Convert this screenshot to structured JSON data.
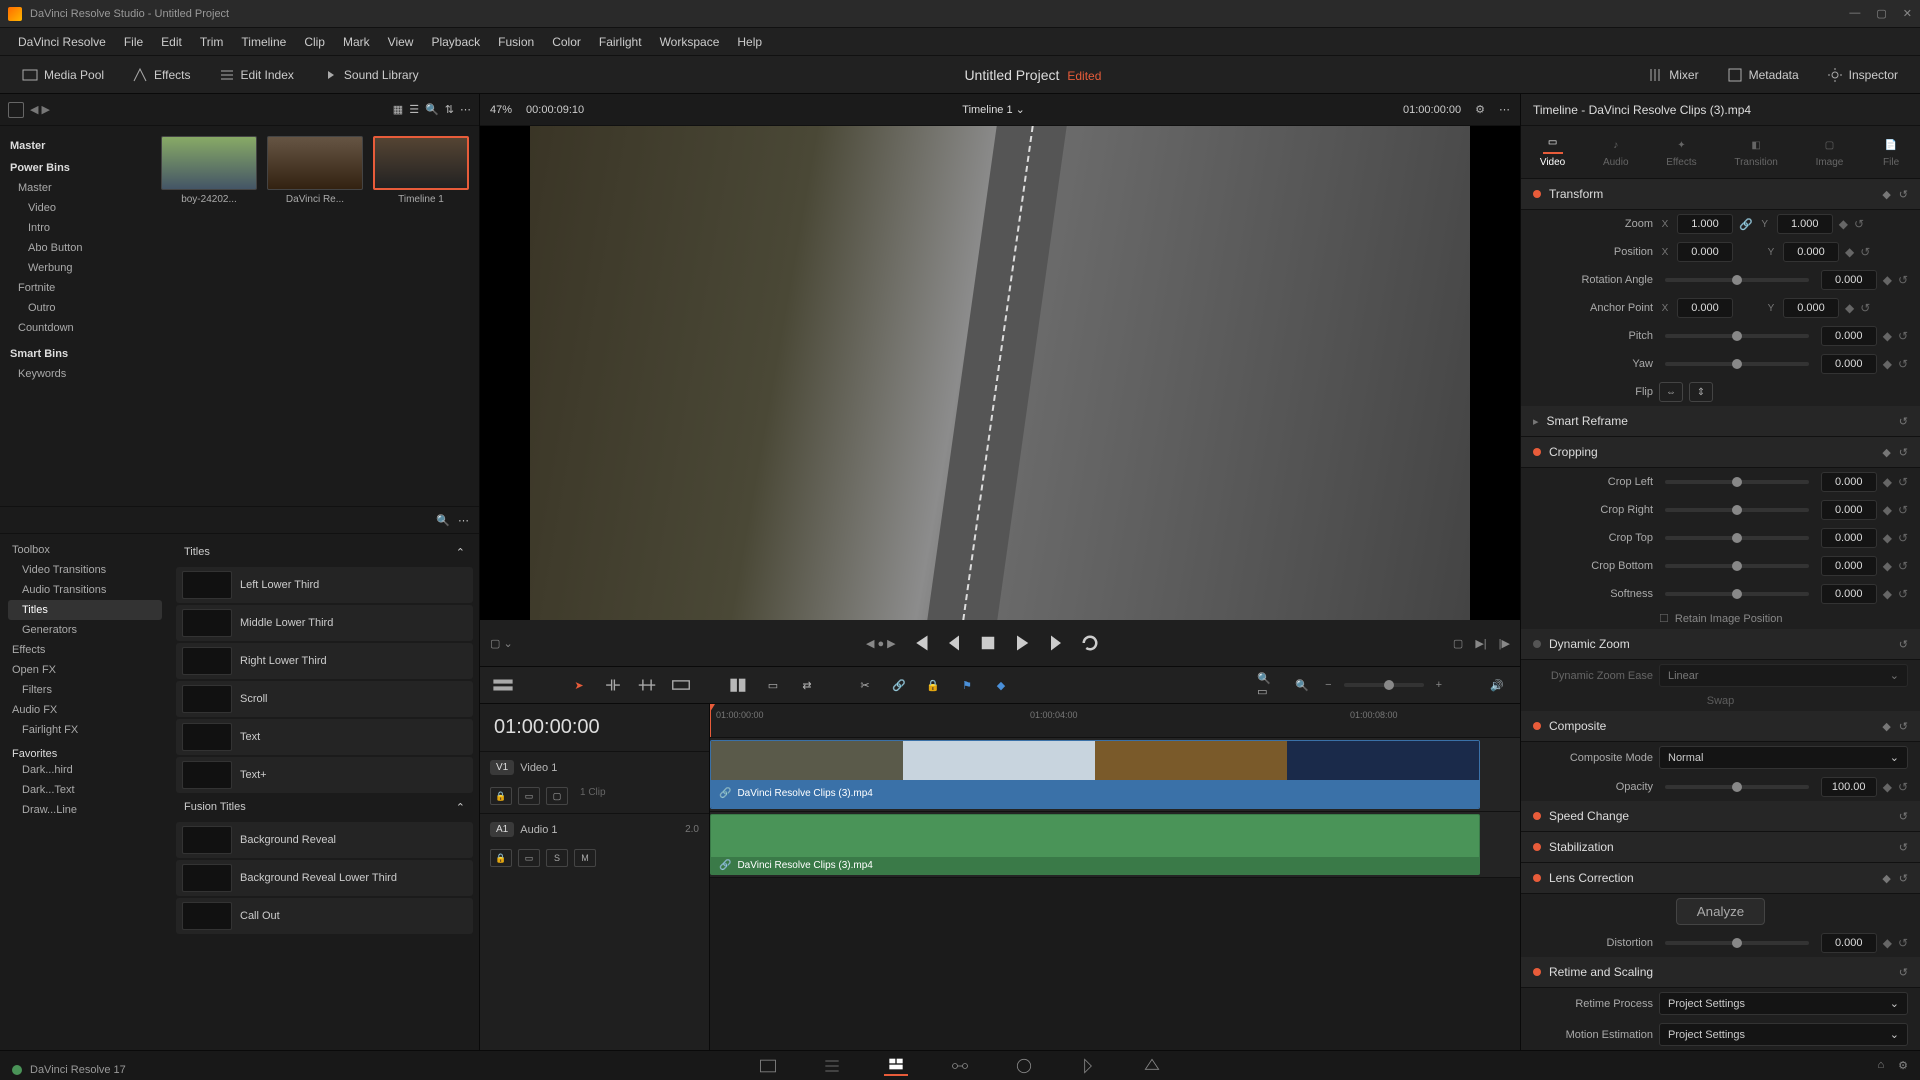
{
  "titlebar": {
    "text": "DaVinci Resolve Studio - Untitled Project"
  },
  "menu": [
    "DaVinci Resolve",
    "File",
    "Edit",
    "Trim",
    "Timeline",
    "Clip",
    "Mark",
    "View",
    "Playback",
    "Fusion",
    "Color",
    "Fairlight",
    "Workspace",
    "Help"
  ],
  "topbar": {
    "mediapool": "Media Pool",
    "effects": "Effects",
    "editindex": "Edit Index",
    "soundlib": "Sound Library",
    "project": "Untitled Project",
    "edited": "Edited",
    "mixer": "Mixer",
    "metadata": "Metadata",
    "inspector": "Inspector"
  },
  "viewer": {
    "zoom": "47%",
    "src_tc": "00:00:09:10",
    "name": "Timeline 1",
    "rec_tc": "01:00:00:00"
  },
  "bins": {
    "master": "Master",
    "power": "Power Bins",
    "items": [
      "Master",
      "Video",
      "Intro",
      "Abo Button",
      "Werbung",
      "Fortnite",
      "Outro",
      "Countdown"
    ],
    "smart": "Smart Bins",
    "keywords": "Keywords"
  },
  "thumbs": [
    {
      "label": "boy-24202..."
    },
    {
      "label": "DaVinci Re..."
    },
    {
      "label": "Timeline 1"
    }
  ],
  "fx": {
    "toolbox": "Toolbox",
    "tree": [
      "Video Transitions",
      "Audio Transitions",
      "Titles",
      "Generators"
    ],
    "effects": "Effects",
    "openfx": "Open FX",
    "filters": "Filters",
    "audiofx": "Audio FX",
    "fairlightfx": "Fairlight FX",
    "favorites": "Favorites",
    "favs": [
      "Dark...hird",
      "Dark...Text",
      "Draw...Line"
    ],
    "group1": "Titles",
    "titles": [
      "Left Lower Third",
      "Middle Lower Third",
      "Right Lower Third",
      "Scroll",
      "Text",
      "Text+"
    ],
    "group2": "Fusion Titles",
    "fusion": [
      "Background Reveal",
      "Background Reveal Lower Third",
      "Call Out"
    ]
  },
  "timeline": {
    "tc": "01:00:00:00",
    "v_label": "Video 1",
    "v_badge": "V1",
    "v_sub": "1 Clip",
    "a_label": "Audio 1",
    "a_badge": "A1",
    "a_ch": "2.0",
    "clip": "DaVinci Resolve Clips (3).mp4",
    "ticks": [
      "01:00:00:00",
      "01:00:04:00",
      "01:00:08:00"
    ]
  },
  "inspector": {
    "title": "Timeline - DaVinci Resolve Clips (3).mp4",
    "tabs": [
      "Video",
      "Audio",
      "Effects",
      "Transition",
      "Image",
      "File"
    ],
    "transform": {
      "title": "Transform",
      "zoom": "Zoom",
      "zoom_x": "1.000",
      "zoom_y": "1.000",
      "pos": "Position",
      "pos_x": "0.000",
      "pos_y": "0.000",
      "rot": "Rotation Angle",
      "rot_v": "0.000",
      "anchor": "Anchor Point",
      "anchor_x": "0.000",
      "anchor_y": "0.000",
      "pitch": "Pitch",
      "pitch_v": "0.000",
      "yaw": "Yaw",
      "yaw_v": "0.000",
      "flip": "Flip"
    },
    "smart_reframe": "Smart Reframe",
    "cropping": {
      "title": "Cropping",
      "left": "Crop Left",
      "left_v": "0.000",
      "right": "Crop Right",
      "right_v": "0.000",
      "top": "Crop Top",
      "top_v": "0.000",
      "bottom": "Crop Bottom",
      "bottom_v": "0.000",
      "soft": "Softness",
      "soft_v": "0.000",
      "retain": "Retain Image Position"
    },
    "dynamic_zoom": {
      "title": "Dynamic Zoom",
      "ease": "Dynamic Zoom Ease",
      "ease_v": "Linear",
      "swap": "Swap"
    },
    "composite": {
      "title": "Composite",
      "mode": "Composite Mode",
      "mode_v": "Normal",
      "opacity": "Opacity",
      "opacity_v": "100.00"
    },
    "speed": "Speed Change",
    "stab": "Stabilization",
    "lens": {
      "title": "Lens Correction",
      "analyze": "Analyze",
      "dist": "Distortion",
      "dist_v": "0.000"
    },
    "retime": {
      "title": "Retime and Scaling",
      "proc": "Retime Process",
      "proc_v": "Project Settings",
      "me": "Motion Estimation",
      "me_v": "Project Settings"
    }
  },
  "status": "DaVinci Resolve 17"
}
